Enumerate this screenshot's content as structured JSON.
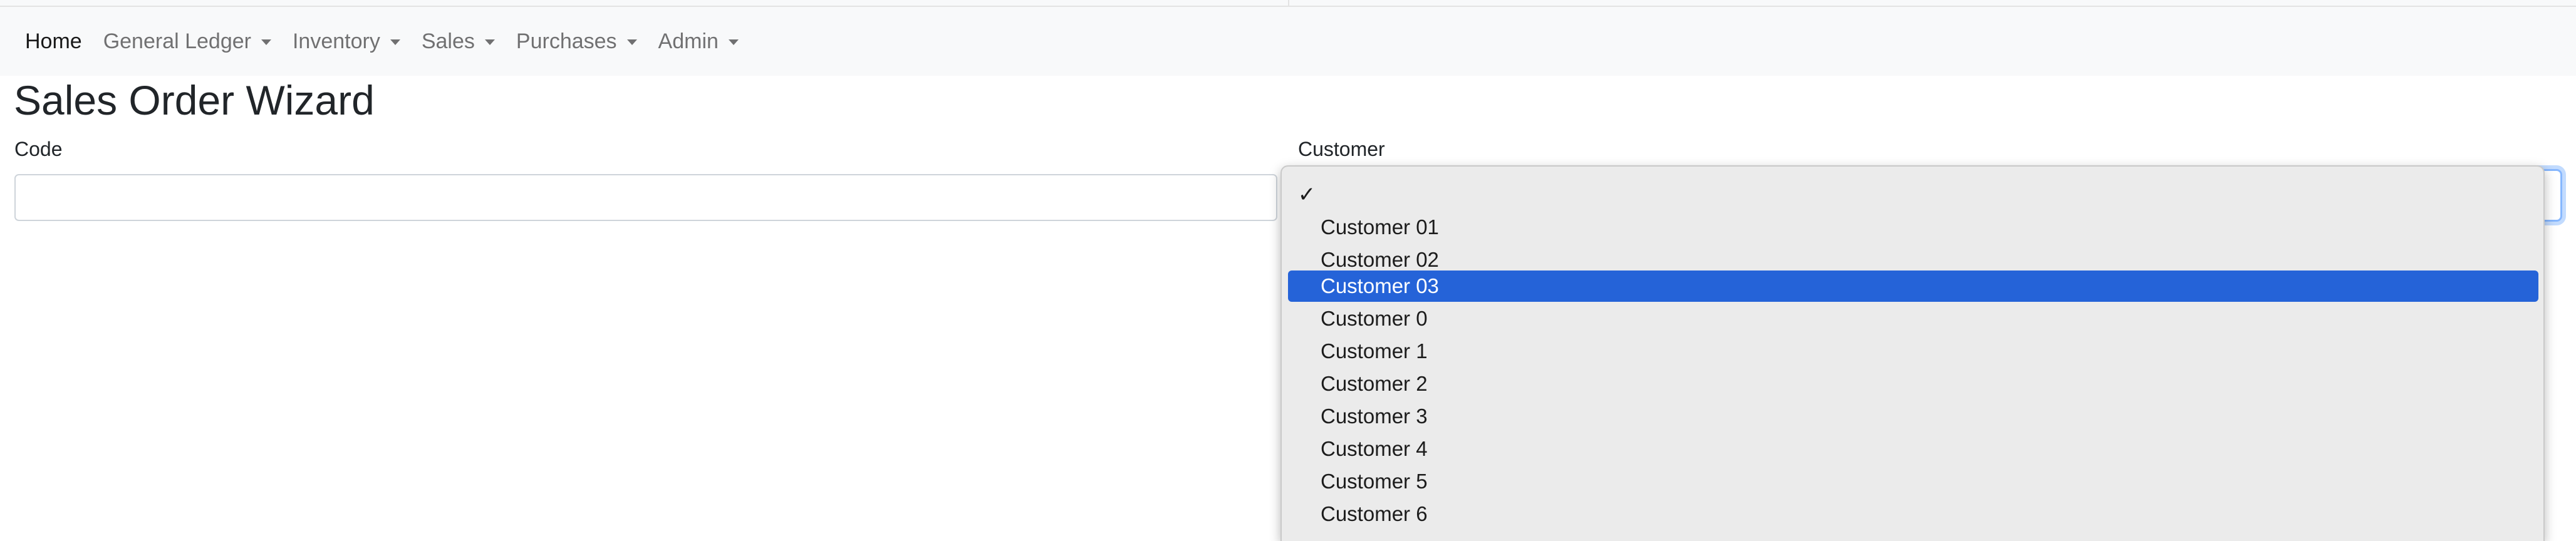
{
  "navbar": {
    "items": [
      {
        "label": "Home",
        "active": true,
        "has_caret": false
      },
      {
        "label": "General Ledger",
        "active": false,
        "has_caret": true
      },
      {
        "label": "Inventory",
        "active": false,
        "has_caret": true
      },
      {
        "label": "Sales",
        "active": false,
        "has_caret": true
      },
      {
        "label": "Purchases",
        "active": false,
        "has_caret": true
      },
      {
        "label": "Admin",
        "active": false,
        "has_caret": true
      }
    ]
  },
  "page": {
    "title": "Sales Order Wizard"
  },
  "form": {
    "code": {
      "label": "Code",
      "value": ""
    },
    "customer": {
      "label": "Customer",
      "selected_value": "",
      "options": [
        {
          "label": "",
          "checked": true,
          "highlighted": false
        },
        {
          "label": "Customer 01",
          "checked": false,
          "highlighted": false
        },
        {
          "label": "Customer 02",
          "checked": false,
          "highlighted": false
        },
        {
          "label": "Customer 03",
          "checked": false,
          "highlighted": true
        },
        {
          "label": "Customer 0",
          "checked": false,
          "highlighted": false
        },
        {
          "label": "Customer 1",
          "checked": false,
          "highlighted": false
        },
        {
          "label": "Customer 2",
          "checked": false,
          "highlighted": false
        },
        {
          "label": "Customer 3",
          "checked": false,
          "highlighted": false
        },
        {
          "label": "Customer 4",
          "checked": false,
          "highlighted": false
        },
        {
          "label": "Customer 5",
          "checked": false,
          "highlighted": false
        },
        {
          "label": "Customer 6",
          "checked": false,
          "highlighted": false
        }
      ]
    }
  },
  "icons": {
    "checkmark": "✓"
  },
  "colors": {
    "highlight": "#2563d8",
    "focus_ring": "#86b7fe",
    "navbar_bg": "#f8f9fa",
    "dropdown_bg": "#ebebeb"
  }
}
